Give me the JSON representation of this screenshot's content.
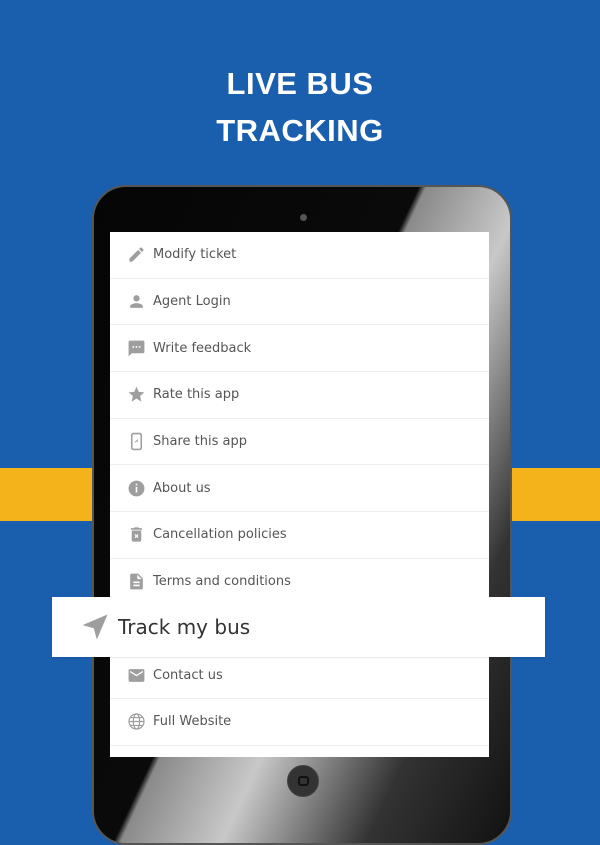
{
  "title": {
    "line1": "LIVE BUS",
    "line2": "TRACKING"
  },
  "colors": {
    "background": "#1a5fae",
    "band": "#f4b21b",
    "icon": "#9e9e9e"
  },
  "menu": [
    {
      "label": "Modify ticket",
      "icon": "pencil-icon"
    },
    {
      "label": "Agent Login",
      "icon": "person-icon"
    },
    {
      "label": "Write feedback",
      "icon": "feedback-icon"
    },
    {
      "label": "Rate this app",
      "icon": "star-icon"
    },
    {
      "label": "Share this app",
      "icon": "share-phone-icon"
    },
    {
      "label": "About us",
      "icon": "info-icon"
    },
    {
      "label": "Cancellation policies",
      "icon": "trash-icon"
    },
    {
      "label": "Terms and conditions",
      "icon": "document-icon"
    },
    {
      "label": "",
      "icon": ""
    },
    {
      "label": "Contact us",
      "icon": "mail-icon"
    },
    {
      "label": "Full Website",
      "icon": "globe-icon"
    },
    {
      "label": "",
      "icon": "phone-icon"
    }
  ],
  "highlight": {
    "label": "Track my bus",
    "icon": "navigation-arrow-icon"
  }
}
